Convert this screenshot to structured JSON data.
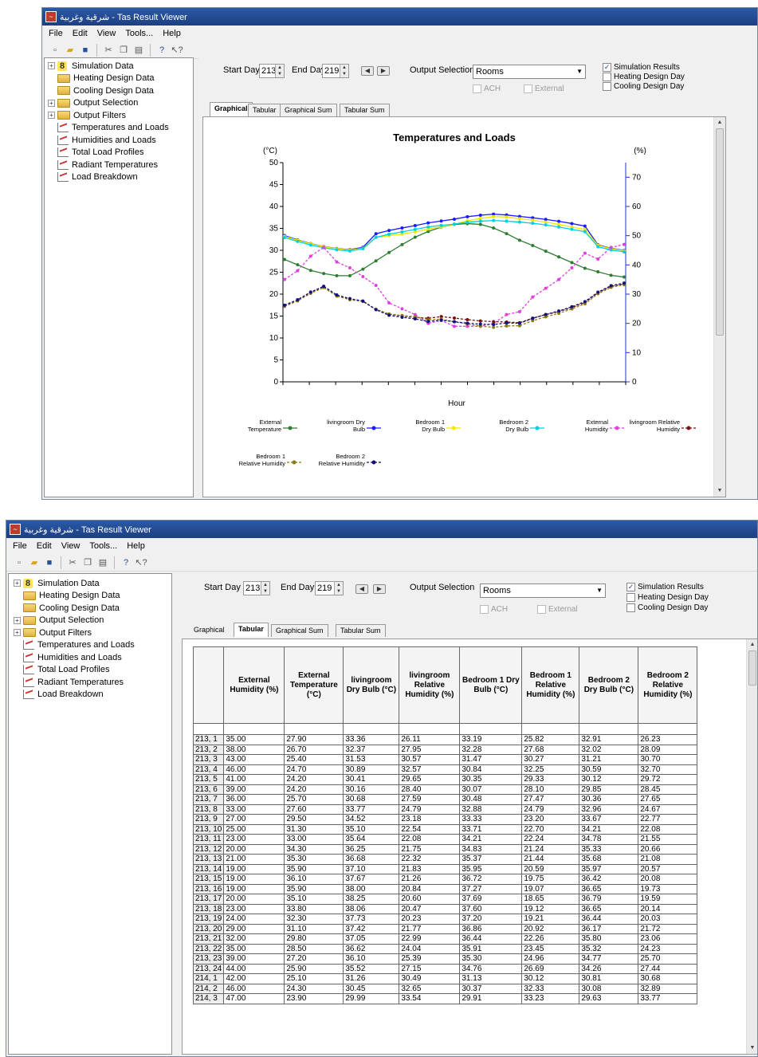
{
  "window1": {
    "title": "شرقية وغربية - Tas Result Viewer",
    "menu": [
      "File",
      "Edit",
      "View",
      "Tools...",
      "Help"
    ],
    "tree": [
      {
        "label": "Simulation Data",
        "type": "sim",
        "expandable": true
      },
      {
        "label": "Heating Design Data",
        "type": "folder",
        "expandable": false
      },
      {
        "label": "Cooling Design Data",
        "type": "folder",
        "expandable": false
      },
      {
        "label": "Output Selection",
        "type": "folder",
        "expandable": true
      },
      {
        "label": "Output Filters",
        "type": "folder",
        "expandable": true
      },
      {
        "label": "Temperatures and Loads",
        "type": "graph",
        "expandable": false
      },
      {
        "label": "Humidities and Loads",
        "type": "graph",
        "expandable": false
      },
      {
        "label": "Total Load Profiles",
        "type": "graph",
        "expandable": false
      },
      {
        "label": "Radiant Temperatures",
        "type": "graph",
        "expandable": false
      },
      {
        "label": "Load Breakdown",
        "type": "graph",
        "expandable": false
      }
    ],
    "controls": {
      "start_day_label": "Start Day",
      "start_day_value": "213",
      "end_day_label": "End Day",
      "end_day_value": "219",
      "output_selection_label": "Output Selection",
      "output_selection_value": "Rooms",
      "ach_label": "ACH",
      "external_label": "External",
      "simulation_results_label": "Simulation Results",
      "simulation_results_checked": true,
      "heating_design_day_label": "Heating Design Day",
      "cooling_design_day_label": "Cooling Design Day"
    },
    "tabs": [
      "Graphical",
      "Tabular",
      "Graphical Sum",
      "Tabular Sum"
    ],
    "active_tab": "Graphical"
  },
  "chart_data": {
    "type": "line",
    "title": "Temperatures and Loads",
    "xlabel": "Hour",
    "ylabel_left": "(°C)",
    "ylabel_right": "(%)",
    "ylim_left": [
      0,
      50
    ],
    "yticks_left": [
      "50",
      "45",
      "40",
      "35",
      "30",
      "25",
      "20",
      "15",
      "10",
      "5",
      "0"
    ],
    "ylim_right": [
      0,
      75
    ],
    "yticks_right": [
      "70",
      "60",
      "50",
      "40",
      "30",
      "20",
      "10",
      "0"
    ],
    "legend_position": "bottom",
    "series": [
      {
        "name": "External Temperature",
        "axis": "left",
        "color": "#2e7d32",
        "values": [
          27.9,
          26.7,
          25.4,
          24.7,
          24.2,
          24.2,
          25.7,
          27.6,
          29.5,
          31.3,
          33.0,
          34.3,
          35.3,
          35.9,
          36.1,
          35.9,
          35.1,
          33.8,
          32.3,
          31.1,
          29.8,
          28.5,
          27.2,
          25.9,
          25.1,
          24.3,
          23.9
        ]
      },
      {
        "name": "livingroom Dry Bulb",
        "axis": "left",
        "color": "#1a1aff",
        "values": [
          33.36,
          32.37,
          31.53,
          30.89,
          30.41,
          30.16,
          30.68,
          33.77,
          34.52,
          35.1,
          35.64,
          36.25,
          36.68,
          37.1,
          37.67,
          38.0,
          38.25,
          38.06,
          37.73,
          37.42,
          37.05,
          36.62,
          36.1,
          35.52,
          31.26,
          30.45,
          29.99
        ]
      },
      {
        "name": "Bedroom 1 Dry Bulb",
        "axis": "left",
        "color": "#f2e600",
        "values": [
          33.19,
          32.28,
          31.47,
          30.84,
          30.35,
          30.07,
          30.48,
          32.88,
          33.33,
          33.71,
          34.21,
          34.83,
          35.37,
          35.95,
          36.72,
          37.27,
          37.69,
          37.6,
          37.2,
          36.86,
          36.44,
          35.91,
          35.3,
          34.76,
          31.13,
          30.37,
          29.91
        ]
      },
      {
        "name": "Bedroom 2 Dry Bulb",
        "axis": "left",
        "color": "#00d0e0",
        "values": [
          32.91,
          32.02,
          31.21,
          30.59,
          30.12,
          29.85,
          30.36,
          32.96,
          33.67,
          34.21,
          34.78,
          35.33,
          35.68,
          35.97,
          36.42,
          36.65,
          36.79,
          36.65,
          36.44,
          36.17,
          35.8,
          35.32,
          34.77,
          34.26,
          30.81,
          30.08,
          29.63
        ]
      },
      {
        "name": "External Humidity",
        "axis": "right",
        "color": "#e040e0",
        "values": [
          35,
          38,
          43,
          46,
          41,
          39,
          36,
          33,
          27,
          25,
          23,
          20,
          21,
          19,
          19,
          19,
          20,
          23,
          24,
          29,
          32,
          35,
          39,
          44,
          42,
          46,
          47
        ]
      },
      {
        "name": "livingroom Relative Humidity",
        "axis": "right",
        "color": "#7a1010",
        "values": [
          26.11,
          27.95,
          30.57,
          32.57,
          29.65,
          28.4,
          27.59,
          24.79,
          23.18,
          22.54,
          22.08,
          21.75,
          22.32,
          21.83,
          21.26,
          20.84,
          20.6,
          20.47,
          20.23,
          21.77,
          22.99,
          24.04,
          25.39,
          27.15,
          30.49,
          32.65,
          33.54
        ]
      },
      {
        "name": "Bedroom 1 Relative Humidity",
        "axis": "right",
        "color": "#8a7a10",
        "values": [
          25.82,
          27.68,
          30.27,
          32.25,
          29.33,
          28.1,
          27.47,
          24.79,
          23.2,
          22.7,
          22.24,
          21.24,
          21.44,
          20.59,
          19.75,
          19.07,
          18.65,
          19.12,
          19.21,
          20.92,
          22.26,
          23.45,
          24.96,
          26.69,
          30.12,
          32.33,
          33.23
        ]
      },
      {
        "name": "Bedroom 2 Relative Humidity",
        "axis": "right",
        "color": "#101080",
        "values": [
          26.23,
          28.09,
          30.7,
          32.7,
          29.72,
          28.45,
          27.65,
          24.67,
          22.77,
          22.08,
          21.55,
          20.66,
          21.08,
          20.57,
          20.08,
          19.73,
          19.59,
          20.14,
          20.03,
          21.72,
          23.06,
          24.23,
          25.7,
          27.44,
          30.68,
          32.89,
          33.77
        ]
      }
    ]
  },
  "window2": {
    "title": "شرقية وغربية - Tas Result Viewer",
    "menu": [
      "File",
      "Edit",
      "View",
      "Tools...",
      "Help"
    ],
    "tabs": [
      "Graphical",
      "Tabular",
      "Graphical Sum",
      "Tabular Sum"
    ],
    "active_tab": "Tabular",
    "table": {
      "columns": [
        "External Humidity (%)",
        "External Temperature (°C)",
        "livingroom Dry Bulb (°C)",
        "livingroom Relative Humidity (%)",
        "Bedroom 1 Dry Bulb (°C)",
        "Bedroom 1 Relative Humidity (%)",
        "Bedroom 2 Dry Bulb (°C)",
        "Bedroom 2 Relative Humidity (%)"
      ],
      "rows": [
        [
          "213, 1",
          "35.00",
          "27.90",
          "33.36",
          "26.11",
          "33.19",
          "25.82",
          "32.91",
          "26.23"
        ],
        [
          "213, 2",
          "38.00",
          "26.70",
          "32.37",
          "27.95",
          "32.28",
          "27.68",
          "32.02",
          "28.09"
        ],
        [
          "213, 3",
          "43.00",
          "25.40",
          "31.53",
          "30.57",
          "31.47",
          "30.27",
          "31.21",
          "30.70"
        ],
        [
          "213, 4",
          "46.00",
          "24.70",
          "30.89",
          "32.57",
          "30.84",
          "32.25",
          "30.59",
          "32.70"
        ],
        [
          "213, 5",
          "41.00",
          "24.20",
          "30.41",
          "29.65",
          "30.35",
          "29.33",
          "30.12",
          "29.72"
        ],
        [
          "213, 6",
          "39.00",
          "24.20",
          "30.16",
          "28.40",
          "30.07",
          "28.10",
          "29.85",
          "28.45"
        ],
        [
          "213, 7",
          "36.00",
          "25.70",
          "30.68",
          "27.59",
          "30.48",
          "27.47",
          "30.36",
          "27.65"
        ],
        [
          "213, 8",
          "33.00",
          "27.60",
          "33.77",
          "24.79",
          "32.88",
          "24.79",
          "32.96",
          "24.67"
        ],
        [
          "213, 9",
          "27.00",
          "29.50",
          "34.52",
          "23.18",
          "33.33",
          "23.20",
          "33.67",
          "22.77"
        ],
        [
          "213, 10",
          "25.00",
          "31.30",
          "35.10",
          "22.54",
          "33.71",
          "22.70",
          "34.21",
          "22.08"
        ],
        [
          "213, 11",
          "23.00",
          "33.00",
          "35.64",
          "22.08",
          "34.21",
          "22.24",
          "34.78",
          "21.55"
        ],
        [
          "213, 12",
          "20.00",
          "34.30",
          "36.25",
          "21.75",
          "34.83",
          "21.24",
          "35.33",
          "20.66"
        ],
        [
          "213, 13",
          "21.00",
          "35.30",
          "36.68",
          "22.32",
          "35.37",
          "21.44",
          "35.68",
          "21.08"
        ],
        [
          "213, 14",
          "19.00",
          "35.90",
          "37.10",
          "21.83",
          "35.95",
          "20.59",
          "35.97",
          "20.57"
        ],
        [
          "213, 15",
          "19.00",
          "36.10",
          "37.67",
          "21.26",
          "36.72",
          "19.75",
          "36.42",
          "20.08"
        ],
        [
          "213, 16",
          "19.00",
          "35.90",
          "38.00",
          "20.84",
          "37.27",
          "19.07",
          "36.65",
          "19.73"
        ],
        [
          "213, 17",
          "20.00",
          "35.10",
          "38.25",
          "20.60",
          "37.69",
          "18.65",
          "36.79",
          "19.59"
        ],
        [
          "213, 18",
          "23.00",
          "33.80",
          "38.06",
          "20.47",
          "37.60",
          "19.12",
          "36.65",
          "20.14"
        ],
        [
          "213, 19",
          "24.00",
          "32.30",
          "37.73",
          "20.23",
          "37.20",
          "19.21",
          "36.44",
          "20.03"
        ],
        [
          "213, 20",
          "29.00",
          "31.10",
          "37.42",
          "21.77",
          "36.86",
          "20.92",
          "36.17",
          "21.72"
        ],
        [
          "213, 21",
          "32.00",
          "29.80",
          "37.05",
          "22.99",
          "36.44",
          "22.26",
          "35.80",
          "23.06"
        ],
        [
          "213, 22",
          "35.00",
          "28.50",
          "36.62",
          "24.04",
          "35.91",
          "23.45",
          "35.32",
          "24.23"
        ],
        [
          "213, 23",
          "39.00",
          "27.20",
          "36.10",
          "25.39",
          "35.30",
          "24.96",
          "34.77",
          "25.70"
        ],
        [
          "213, 24",
          "44.00",
          "25.90",
          "35.52",
          "27.15",
          "34.76",
          "26.69",
          "34.26",
          "27.44"
        ],
        [
          "214, 1",
          "42.00",
          "25.10",
          "31.26",
          "30.49",
          "31.13",
          "30.12",
          "30.81",
          "30.68"
        ],
        [
          "214, 2",
          "46.00",
          "24.30",
          "30.45",
          "32.65",
          "30.37",
          "32.33",
          "30.08",
          "32.89"
        ],
        [
          "214, 3",
          "47.00",
          "23.90",
          "29.99",
          "33.54",
          "29.91",
          "33.23",
          "29.63",
          "33.77"
        ]
      ]
    }
  }
}
